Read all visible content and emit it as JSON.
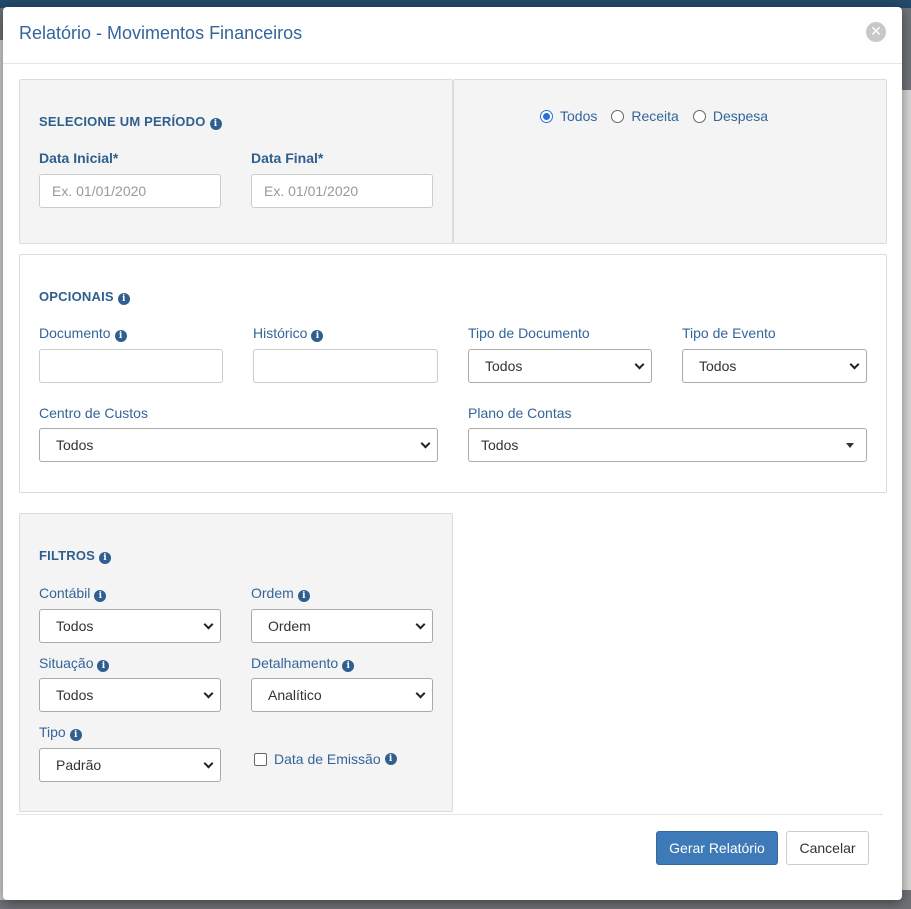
{
  "modal": {
    "title": "Relatório - Movimentos Financeiros",
    "close_glyph": "✕"
  },
  "periodo": {
    "title": "SELECIONE UM PERÍODO",
    "data_inicial_label": "Data Inicial*",
    "data_inicial_placeholder": "Ex. 01/01/2020",
    "data_final_label": "Data Final*",
    "data_final_placeholder": "Ex. 01/01/2020"
  },
  "tipo_movimento": {
    "options": [
      "Todos",
      "Receita",
      "Despesa"
    ],
    "selected": "Todos"
  },
  "opcionais": {
    "title": "OPCIONAIS",
    "documento_label": "Documento",
    "historico_label": "Histórico",
    "tipo_documento_label": "Tipo de Documento",
    "tipo_documento_value": "Todos",
    "tipo_evento_label": "Tipo de Evento",
    "tipo_evento_value": "Todos",
    "centro_custos_label": "Centro de Custos",
    "centro_custos_value": "Todos",
    "plano_contas_label": "Plano de Contas",
    "plano_contas_value": "Todos"
  },
  "filtros": {
    "title": "FILTROS",
    "contabil_label": "Contábil",
    "contabil_value": "Todos",
    "ordem_label": "Ordem",
    "ordem_value": "Ordem",
    "situacao_label": "Situação",
    "situacao_value": "Todos",
    "detalhamento_label": "Detalhamento",
    "detalhamento_value": "Analítico",
    "tipo_label": "Tipo",
    "tipo_value": "Padrão",
    "data_emissao_label": "Data de Emissão",
    "data_emissao_checked": false
  },
  "footer": {
    "gerar_label": "Gerar Relatório",
    "cancelar_label": "Cancelar"
  },
  "icons": {
    "info": "i"
  },
  "colors": {
    "primary": "#3f7ab8",
    "heading": "#2e5f8f",
    "label": "#33659b"
  }
}
